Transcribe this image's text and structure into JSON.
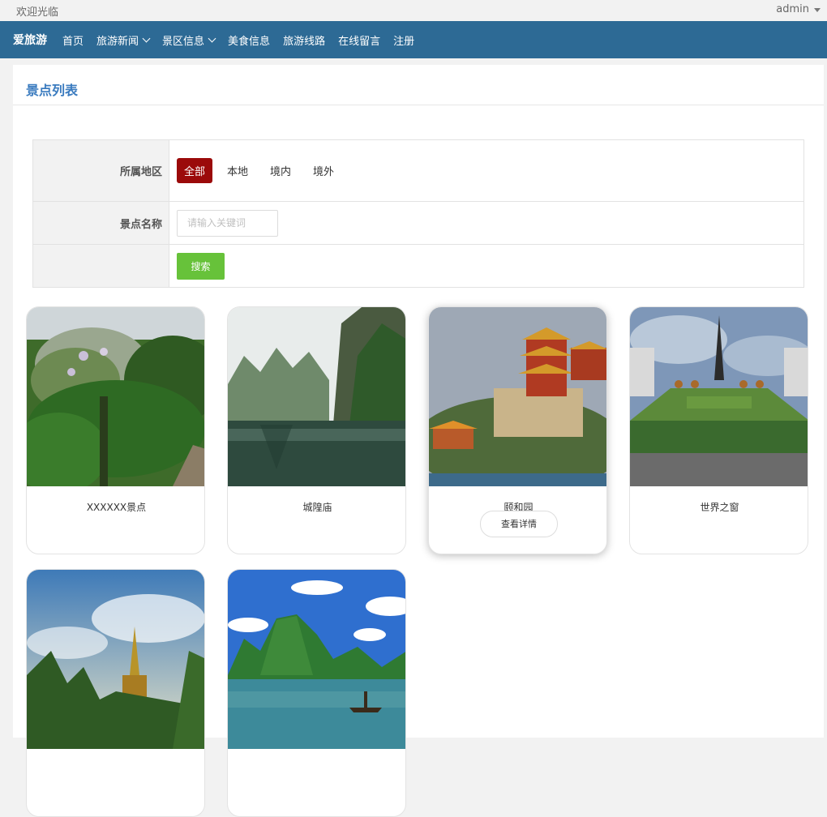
{
  "topbar": {
    "welcome": "欢迎光临",
    "user": "admin"
  },
  "nav": {
    "brand": "爱旅游",
    "items": [
      {
        "label": "首页",
        "dropdown": false
      },
      {
        "label": "旅游新闻",
        "dropdown": true
      },
      {
        "label": "景区信息",
        "dropdown": true
      },
      {
        "label": "美食信息",
        "dropdown": false
      },
      {
        "label": "旅游线路",
        "dropdown": false
      },
      {
        "label": "在线留言",
        "dropdown": false
      },
      {
        "label": "注册",
        "dropdown": false
      }
    ]
  },
  "page": {
    "title": "景点列表"
  },
  "filter": {
    "region_label": "所属地区",
    "regions": [
      "全部",
      "本地",
      "境内",
      "境外"
    ],
    "active_region": "全部",
    "name_label": "景点名称",
    "name_placeholder": "请输入关键词",
    "search_button": "搜索"
  },
  "cards": [
    {
      "name": "XXXXXX景点",
      "image_icon": "forest-scene-image"
    },
    {
      "name": "城隍庙",
      "image_icon": "karst-lake-image"
    },
    {
      "name": "颐和园",
      "image_icon": "pagoda-palace-image",
      "detail_button": "查看详情",
      "hover": true
    },
    {
      "name": "世界之窗",
      "image_icon": "eiffel-tower-park-image"
    },
    {
      "name": "",
      "image_icon": "golden-stupa-image"
    },
    {
      "name": "",
      "image_icon": "guilin-river-image"
    }
  ],
  "colors": {
    "nav_bg": "#2d6a95",
    "title_blue": "#3a7bbf",
    "active_red": "#9b0a0a",
    "search_green": "#67c23a"
  }
}
